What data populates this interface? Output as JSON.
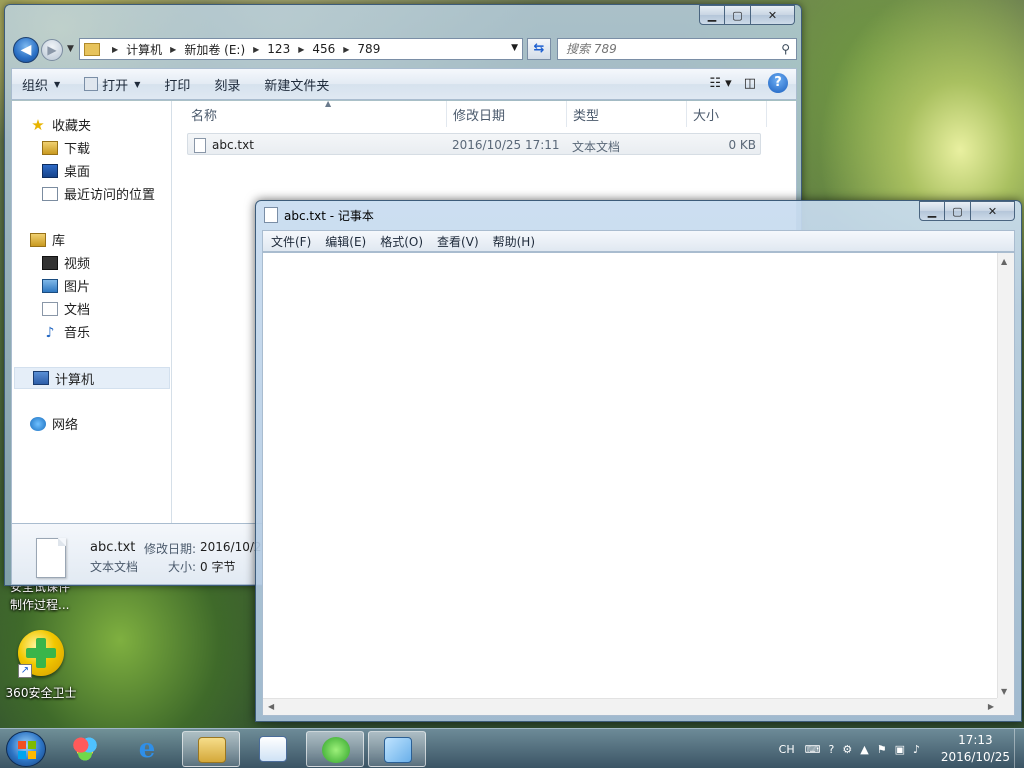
{
  "desktop": {
    "partial_label_line1": "安全试课件",
    "partial_label_line2": "制作过程...",
    "icon_360_label": "360安全卫士"
  },
  "explorer": {
    "breadcrumbs": [
      "计算机",
      "新加卷 (E:)",
      "123",
      "456",
      "789"
    ],
    "search_placeholder": "搜索 789",
    "toolbar": {
      "organize": "组织",
      "open": "打开",
      "print": "打印",
      "burn": "刻录",
      "new_folder": "新建文件夹"
    },
    "nav": {
      "favorites": "收藏夹",
      "downloads": "下载",
      "desktop": "桌面",
      "recent": "最近访问的位置",
      "libraries": "库",
      "videos": "视频",
      "pictures": "图片",
      "documents": "文档",
      "music": "音乐",
      "computer": "计算机",
      "network": "网络"
    },
    "columns": {
      "name": "名称",
      "modified": "修改日期",
      "type": "类型",
      "size": "大小"
    },
    "files": [
      {
        "name": "abc.txt",
        "modified": "2016/10/25 17:11",
        "type": "文本文档",
        "size": "0 KB"
      }
    ],
    "details": {
      "filename": "abc.txt",
      "modified_label": "修改日期:",
      "modified_value": "2016/10/2",
      "type": "文本文档",
      "size_label": "大小:",
      "size_value": "0 字节"
    }
  },
  "notepad": {
    "title": "abc.txt - 记事本",
    "menu": [
      "文件(F)",
      "编辑(E)",
      "格式(O)",
      "查看(V)",
      "帮助(H)"
    ],
    "content": ""
  },
  "taskbar": {
    "language": "CH",
    "time": "17:13",
    "date": "2016/10/25"
  }
}
